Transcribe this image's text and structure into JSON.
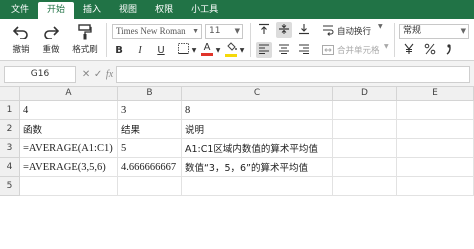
{
  "menu": {
    "tabs": [
      "文件",
      "开始",
      "插入",
      "视图",
      "权限",
      "小工具"
    ],
    "active_index": 1
  },
  "ribbon": {
    "undo_label": "撤销",
    "redo_label": "重做",
    "format_painter_label": "格式刷",
    "font_name": "Times New Roman",
    "font_size": "11",
    "bold_label": "B",
    "italic_label": "I",
    "underline_label": "U",
    "font_color_label": "A",
    "wrap_text_label": "自动换行",
    "merge_label": "合并单元格",
    "number_format": "常规"
  },
  "formula_bar": {
    "name_box": "G16",
    "fx_label": "fx",
    "formula": ""
  },
  "sheet": {
    "columns": [
      "A",
      "B",
      "C",
      "D",
      "E"
    ],
    "rows": [
      "1",
      "2",
      "3",
      "4",
      "5"
    ],
    "cells": [
      [
        "4",
        "3",
        "8",
        "",
        ""
      ],
      [
        "函数",
        "结果",
        "说明",
        "",
        ""
      ],
      [
        "=AVERAGE(A1:C1)",
        "5",
        "A1:C1区域内数值的算术平均值",
        "",
        ""
      ],
      [
        "=AVERAGE(3,5,6)",
        "4.666666667",
        "数值“3，5，6”的算术平均值",
        "",
        ""
      ],
      [
        "",
        "",
        "",
        "",
        ""
      ]
    ]
  },
  "colors": {
    "brand": "#217346",
    "font_color_bar": "#e0342a",
    "fill_color_bar": "#f5d90a"
  }
}
